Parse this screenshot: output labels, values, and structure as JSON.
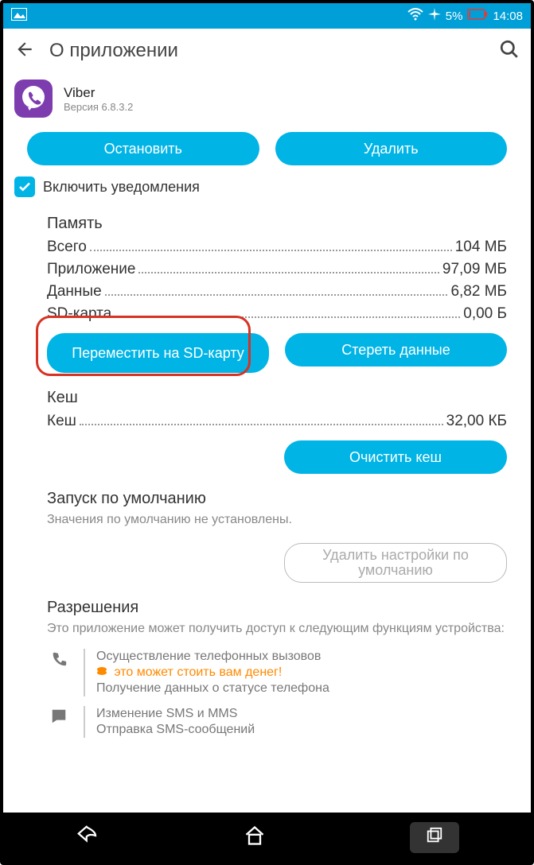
{
  "status": {
    "battery": "5%",
    "time": "14:08"
  },
  "appbar": {
    "title": "О приложении"
  },
  "app": {
    "name": "Viber",
    "version": "Версия 6.8.3.2"
  },
  "buttons": {
    "stop": "Остановить",
    "delete": "Удалить",
    "move_sd": "Переместить на SD-карту",
    "clear_data": "Стереть данные",
    "clear_cache": "Очистить кеш",
    "clear_defaults": "Удалить настройки по умолчанию"
  },
  "checkbox": {
    "notif_label": "Включить уведомления"
  },
  "sections": {
    "memory": {
      "title": "Память",
      "rows": {
        "total_k": "Всего",
        "total_v": "104 МБ",
        "app_k": "Приложение",
        "app_v": "97,09 МБ",
        "data_k": "Данные",
        "data_v": "6,82 МБ",
        "sd_k": "SD-карта",
        "sd_v": "0,00 Б"
      }
    },
    "cache": {
      "title": "Кеш",
      "row_k": "Кеш",
      "row_v": "32,00 КБ"
    },
    "defaults": {
      "title": "Запуск по умолчанию",
      "sub": "Значения по умолчанию не установлены."
    },
    "perms": {
      "title": "Разрешения",
      "sub": "Это приложение может получить доступ к следующим функциям устройства:",
      "phone1": "Осуществление телефонных вызовов",
      "phone_warn": "это может стоить вам денег!",
      "phone2": "Получение данных о статусе телефона",
      "sms1": "Изменение SMS и MMS",
      "sms2": "Отправка SMS-сообщений"
    }
  }
}
